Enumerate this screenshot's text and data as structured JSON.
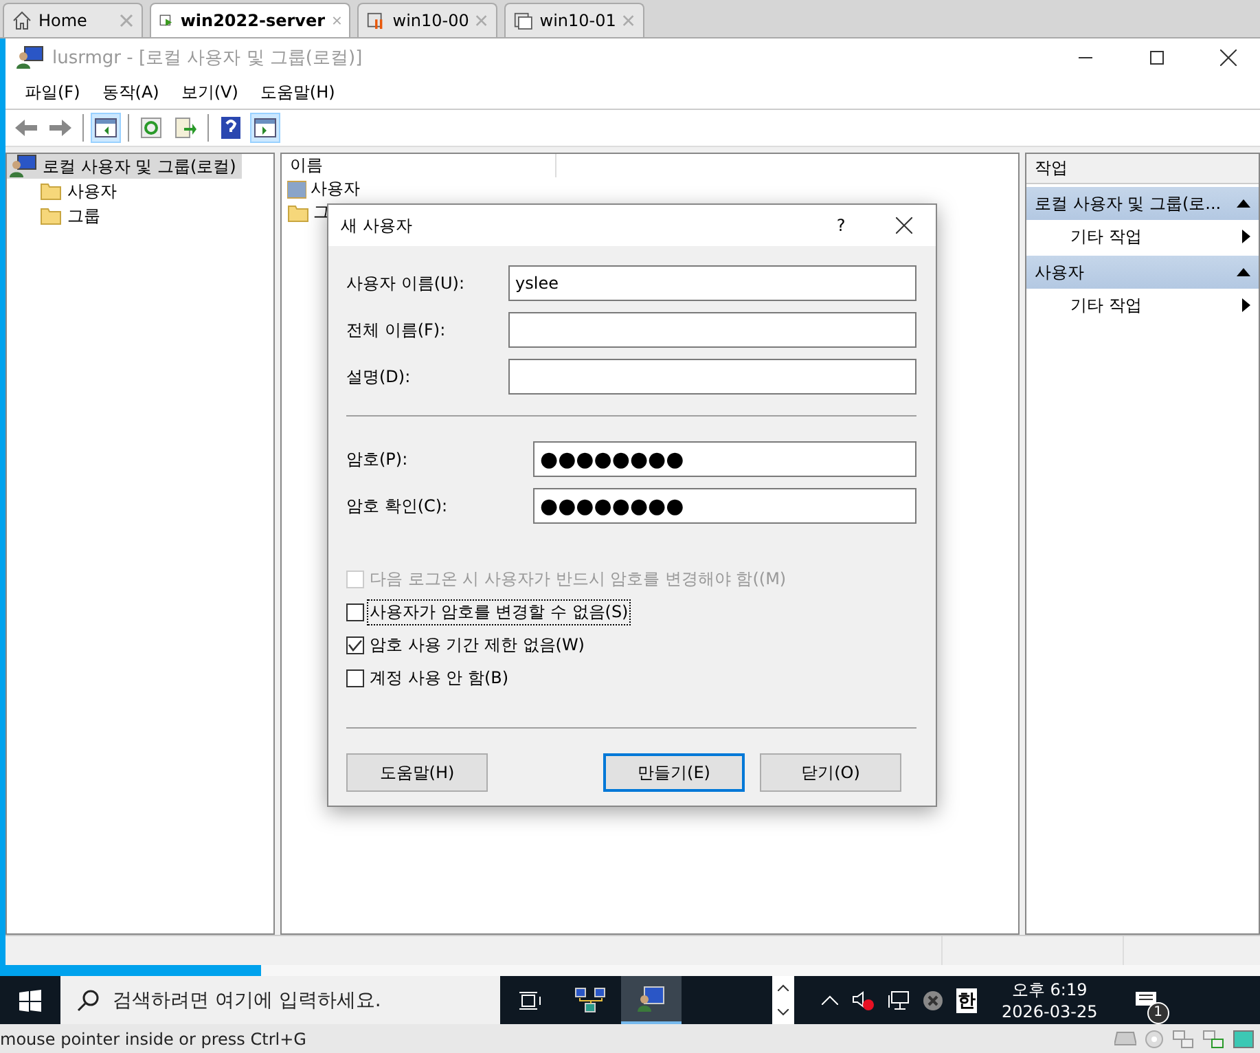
{
  "vm_tabs": [
    {
      "label": "Home",
      "kind": "home",
      "selected": false
    },
    {
      "label": "win2022-server",
      "kind": "running",
      "selected": true
    },
    {
      "label": "win10-00",
      "kind": "paused",
      "selected": false
    },
    {
      "label": "win10-01",
      "kind": "stopped",
      "selected": false
    }
  ],
  "window": {
    "title": "lusrmgr - [로컬 사용자 및 그룹(로컬)]"
  },
  "menu": [
    "파일(F)",
    "동작(A)",
    "보기(V)",
    "도움말(H)"
  ],
  "tree": {
    "label": "로컬 사용자 및 그룹(로컬)",
    "selected": true,
    "children": [
      {
        "label": "사용자"
      },
      {
        "label": "그룹"
      }
    ]
  },
  "list": {
    "column": "이름",
    "items": [
      {
        "label": "사용자",
        "kind": "users"
      },
      {
        "label": "그",
        "kind": "folder"
      }
    ]
  },
  "actions": {
    "title": "작업",
    "sections": [
      {
        "label": "로컬 사용자 및 그룹(로...",
        "expanded": true,
        "items": [
          "기타 작업"
        ]
      },
      {
        "label": "사용자",
        "expanded": true,
        "items": [
          "기타 작업"
        ]
      }
    ]
  },
  "dialog": {
    "title": "새 사용자",
    "help": "?",
    "fields": [
      {
        "label": "사용자 이름(U):",
        "kind": "text",
        "value": "yslee"
      },
      {
        "label": "전체 이름(F):",
        "kind": "text"
      },
      {
        "label": "설명(D):",
        "kind": "text"
      },
      {
        "label": "암호(P):",
        "kind": "password",
        "value": "●●●●●●●●"
      },
      {
        "label": "암호 확인(C):",
        "kind": "password",
        "value": "●●●●●●●●"
      }
    ],
    "checkboxes": [
      {
        "label": "다음 로그온 시 사용자가 반드시 암호를 변경해야 함((M)",
        "checked": false,
        "disabled": true,
        "focused": false
      },
      {
        "label": "사용자가 암호를 변경할 수 없음(S)",
        "checked": false,
        "disabled": false,
        "focused": true
      },
      {
        "label": "암호 사용 기간 제한 없음(W)",
        "checked": true,
        "disabled": false,
        "focused": false
      },
      {
        "label": "계정 사용 안 함(B)",
        "checked": false,
        "disabled": false,
        "focused": false
      }
    ],
    "buttons": [
      {
        "label": "도움말(H)",
        "default": false
      },
      {
        "label": "만들기(E)",
        "default": true
      },
      {
        "label": "닫기(O)",
        "default": false
      }
    ]
  },
  "taskbar": {
    "search_placeholder": "검색하려면 여기에 입력하세요.",
    "ime": "한",
    "time": "오후 6:19",
    "date": "2026-03-25",
    "notifications": "1"
  },
  "vm_status": "mouse pointer inside or press Ctrl+G"
}
